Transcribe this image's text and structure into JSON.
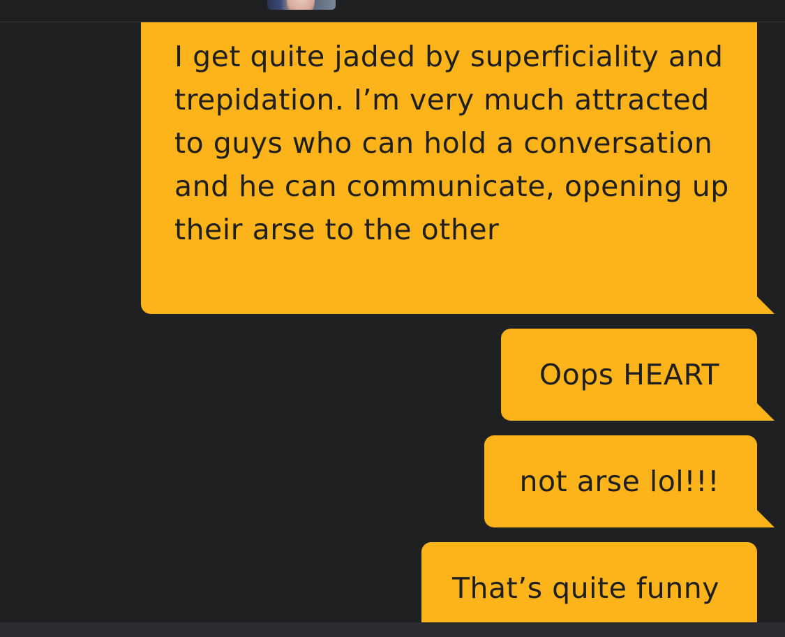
{
  "colors": {
    "background": "#1f2022",
    "bubble": "#fdb31a",
    "bubble_text": "#1f1f1f",
    "bottom_bar": "#2b2c2f"
  },
  "header": {
    "avatar_icon": "profile-photo"
  },
  "messages": [
    {
      "text": "I get quite jaded by superficiality and trepidation. I’m very much attracted to guys who can hold a conversation and he can communicate, opening up their arse to the other"
    },
    {
      "text": "Oops HEART"
    },
    {
      "text": "not arse lol!!!"
    },
    {
      "text": "That’s quite funny"
    }
  ]
}
